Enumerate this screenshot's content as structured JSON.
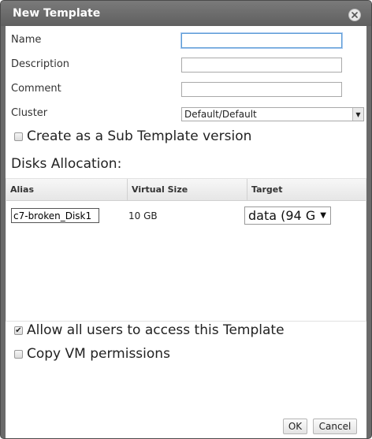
{
  "dialog": {
    "title": "New Template",
    "close_icon": "close-icon"
  },
  "fields": {
    "name": {
      "label": "Name",
      "value": ""
    },
    "description": {
      "label": "Description",
      "value": ""
    },
    "comment": {
      "label": "Comment",
      "value": ""
    },
    "cluster": {
      "label": "Cluster",
      "value": "Default/Default"
    }
  },
  "sub_template": {
    "label": "Create as a Sub Template version",
    "checked": false
  },
  "disks": {
    "title": "Disks Allocation:",
    "columns": [
      "Alias",
      "Virtual Size",
      "Target"
    ],
    "rows": [
      {
        "alias": "c7-broken_Disk1",
        "size": "10 GB",
        "target": "data (94 G"
      }
    ]
  },
  "allow_all": {
    "label": "Allow all users to access this Template",
    "checked": true
  },
  "copy_perms": {
    "label": "Copy VM permissions",
    "checked": false
  },
  "buttons": {
    "ok": "OK",
    "cancel": "Cancel"
  }
}
